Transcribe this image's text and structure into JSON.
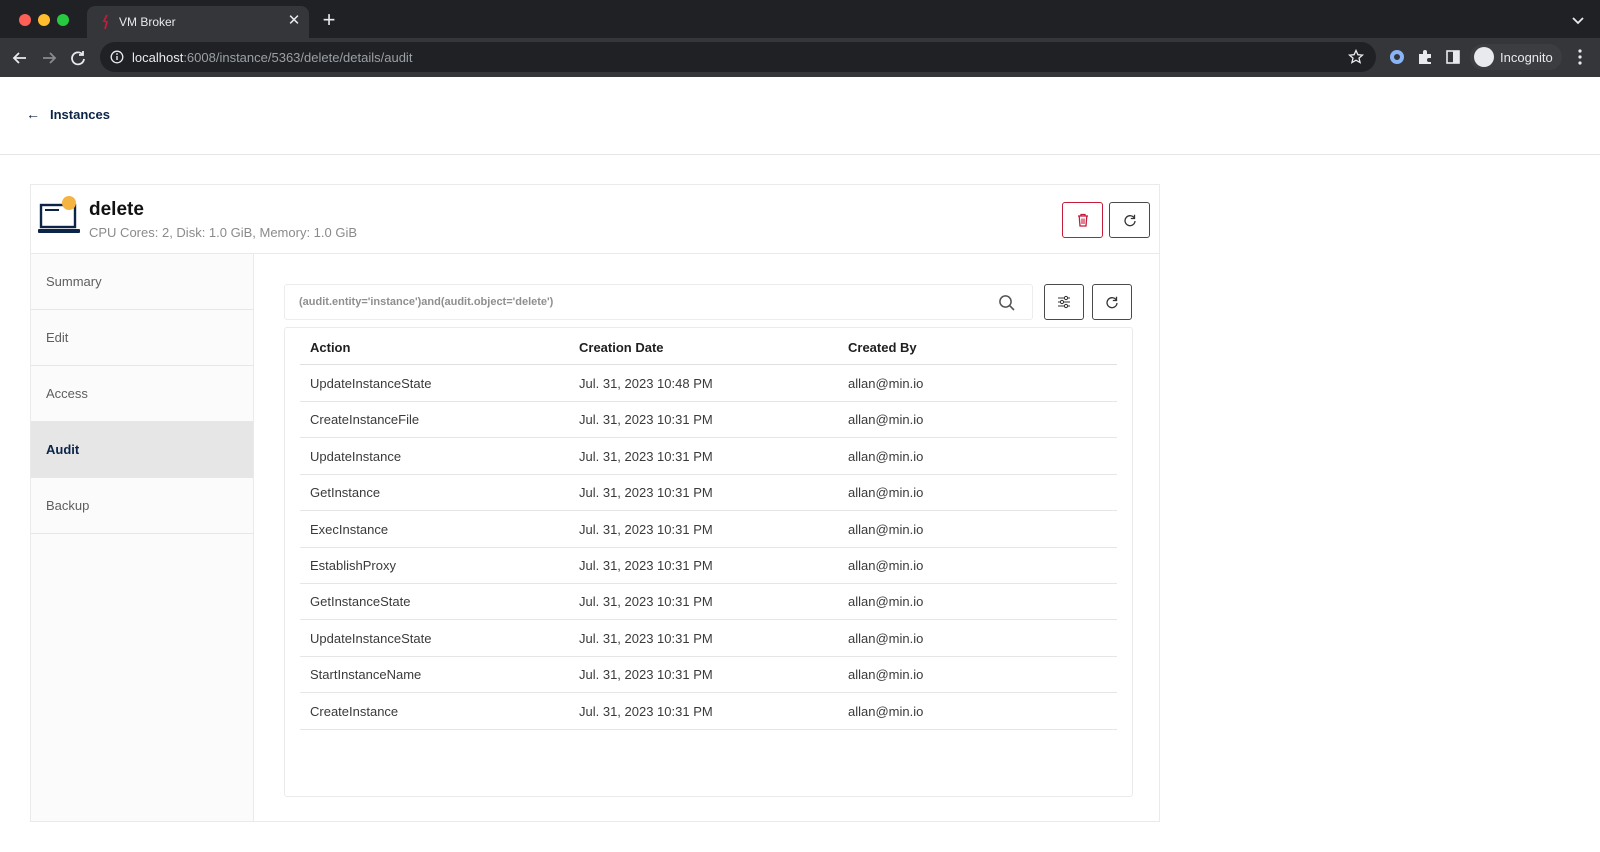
{
  "browser": {
    "tab_title": "VM Broker",
    "url_host": "localhost",
    "url_path": ":6008/instance/5363/delete/details/audit",
    "profile_label": "Incognito"
  },
  "page": {
    "back_label": "Instances",
    "instance": {
      "name": "delete",
      "specs": "CPU Cores: 2, Disk: 1.0 GiB, Memory: 1.0 GiB",
      "status_color": "#f5b342"
    },
    "sidebar": {
      "items": [
        {
          "label": "Summary"
        },
        {
          "label": "Edit"
        },
        {
          "label": "Access"
        },
        {
          "label": "Audit"
        },
        {
          "label": "Backup"
        }
      ],
      "active": "Audit"
    },
    "audit": {
      "search_value": "(audit.entity='instance')and(audit.object='delete')",
      "columns": [
        "Action",
        "Creation Date",
        "Created By"
      ],
      "rows": [
        {
          "action": "UpdateInstanceState",
          "date": "Jul. 31, 2023 10:48 PM",
          "user": "allan@min.io"
        },
        {
          "action": "CreateInstanceFile",
          "date": "Jul. 31, 2023 10:31 PM",
          "user": "allan@min.io"
        },
        {
          "action": "UpdateInstance",
          "date": "Jul. 31, 2023 10:31 PM",
          "user": "allan@min.io"
        },
        {
          "action": "GetInstance",
          "date": "Jul. 31, 2023 10:31 PM",
          "user": "allan@min.io"
        },
        {
          "action": "ExecInstance",
          "date": "Jul. 31, 2023 10:31 PM",
          "user": "allan@min.io"
        },
        {
          "action": "EstablishProxy",
          "date": "Jul. 31, 2023 10:31 PM",
          "user": "allan@min.io"
        },
        {
          "action": "GetInstanceState",
          "date": "Jul. 31, 2023 10:31 PM",
          "user": "allan@min.io"
        },
        {
          "action": "UpdateInstanceState",
          "date": "Jul. 31, 2023 10:31 PM",
          "user": "allan@min.io"
        },
        {
          "action": "StartInstanceName",
          "date": "Jul. 31, 2023 10:31 PM",
          "user": "allan@min.io"
        },
        {
          "action": "CreateInstance",
          "date": "Jul. 31, 2023 10:31 PM",
          "user": "allan@min.io"
        }
      ]
    }
  },
  "colors": {
    "brand_navy": "#0b2447",
    "danger": "#c51b3b"
  },
  "icons": {
    "delete": "trash-icon",
    "refresh": "refresh-icon",
    "filter": "sliders-icon",
    "search": "search-icon"
  }
}
